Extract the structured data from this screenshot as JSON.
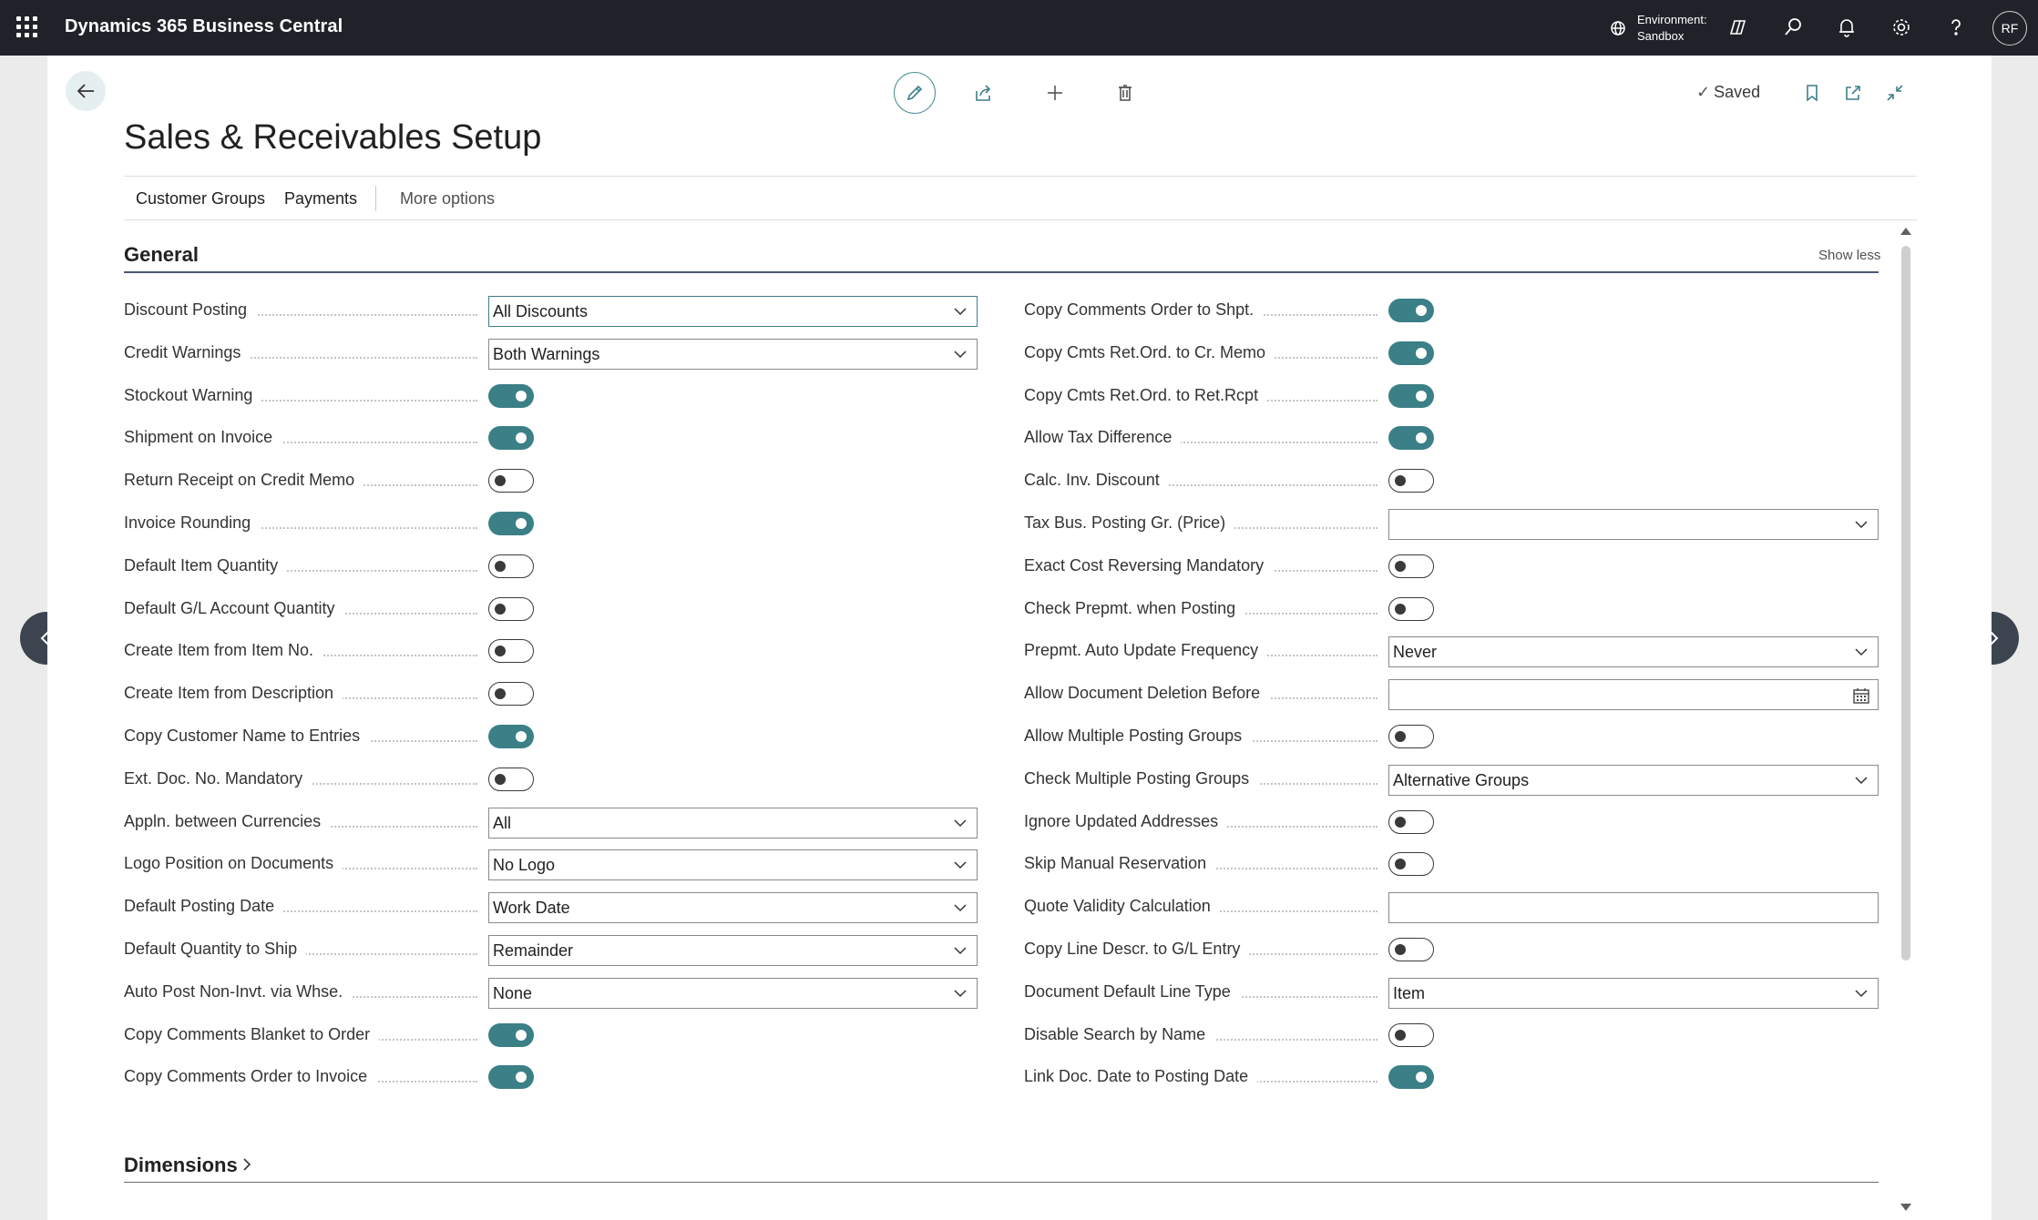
{
  "app": {
    "title": "Dynamics 365 Business Central"
  },
  "environment": {
    "label": "Environment:",
    "name": "Sandbox"
  },
  "user": {
    "initials": "RF"
  },
  "page": {
    "title": "Sales & Receivables Setup",
    "status": "Saved"
  },
  "actions": {
    "customer_groups": "Customer Groups",
    "payments": "Payments",
    "more": "More options"
  },
  "general": {
    "title": "General",
    "show_less": "Show less",
    "left": [
      {
        "label": "Discount Posting",
        "type": "select",
        "value": "All Discounts",
        "focused": true
      },
      {
        "label": "Credit Warnings",
        "type": "select",
        "value": "Both Warnings"
      },
      {
        "label": "Stockout Warning",
        "type": "toggle",
        "on": true
      },
      {
        "label": "Shipment on Invoice",
        "type": "toggle",
        "on": true
      },
      {
        "label": "Return Receipt on Credit Memo",
        "type": "toggle",
        "on": false
      },
      {
        "label": "Invoice Rounding",
        "type": "toggle",
        "on": true
      },
      {
        "label": "Default Item Quantity",
        "type": "toggle",
        "on": false
      },
      {
        "label": "Default G/L Account Quantity",
        "type": "toggle",
        "on": false
      },
      {
        "label": "Create Item from Item No.",
        "type": "toggle",
        "on": false
      },
      {
        "label": "Create Item from Description",
        "type": "toggle",
        "on": false
      },
      {
        "label": "Copy Customer Name to Entries",
        "type": "toggle",
        "on": true
      },
      {
        "label": "Ext. Doc. No. Mandatory",
        "type": "toggle",
        "on": false
      },
      {
        "label": "Appln. between Currencies",
        "type": "select",
        "value": "All"
      },
      {
        "label": "Logo Position on Documents",
        "type": "select",
        "value": "No Logo"
      },
      {
        "label": "Default Posting Date",
        "type": "select",
        "value": "Work Date"
      },
      {
        "label": "Default Quantity to Ship",
        "type": "select",
        "value": "Remainder"
      },
      {
        "label": "Auto Post Non-Invt. via Whse.",
        "type": "select",
        "value": "None"
      },
      {
        "label": "Copy Comments Blanket to Order",
        "type": "toggle",
        "on": true
      },
      {
        "label": "Copy Comments Order to Invoice",
        "type": "toggle",
        "on": true
      }
    ],
    "right": [
      {
        "label": "Copy Comments Order to Shpt.",
        "type": "toggle",
        "on": true
      },
      {
        "label": "Copy Cmts Ret.Ord. to Cr. Memo",
        "type": "toggle",
        "on": true
      },
      {
        "label": "Copy Cmts Ret.Ord. to Ret.Rcpt",
        "type": "toggle",
        "on": true
      },
      {
        "label": "Allow Tax Difference",
        "type": "toggle",
        "on": true
      },
      {
        "label": "Calc. Inv. Discount",
        "type": "toggle",
        "on": false
      },
      {
        "label": "Tax Bus. Posting Gr. (Price)",
        "type": "select",
        "value": ""
      },
      {
        "label": "Exact Cost Reversing Mandatory",
        "type": "toggle",
        "on": false
      },
      {
        "label": "Check Prepmt. when Posting",
        "type": "toggle",
        "on": false
      },
      {
        "label": "Prepmt. Auto Update Frequency",
        "type": "select",
        "value": "Never"
      },
      {
        "label": "Allow Document Deletion Before",
        "type": "date",
        "value": ""
      },
      {
        "label": "Allow Multiple Posting Groups",
        "type": "toggle",
        "on": false
      },
      {
        "label": "Check Multiple Posting Groups",
        "type": "select",
        "value": "Alternative Groups"
      },
      {
        "label": "Ignore Updated Addresses",
        "type": "toggle",
        "on": false
      },
      {
        "label": "Skip Manual Reservation",
        "type": "toggle",
        "on": false
      },
      {
        "label": "Quote Validity Calculation",
        "type": "text",
        "value": ""
      },
      {
        "label": "Copy Line Descr. to G/L Entry",
        "type": "toggle",
        "on": false
      },
      {
        "label": "Document Default Line Type",
        "type": "select",
        "value": "Item"
      },
      {
        "label": "Disable Search by Name",
        "type": "toggle",
        "on": false
      },
      {
        "label": "Link Doc. Date to Posting Date",
        "type": "toggle",
        "on": true
      }
    ]
  },
  "dimensions": {
    "title": "Dimensions"
  },
  "colors": {
    "topbar": "#1f2329",
    "accent": "#3b7f87",
    "section_rule": "#4a5a73"
  },
  "icons": [
    "waffle-icon",
    "environment-icon",
    "copilot-icon",
    "search-icon",
    "bell-icon",
    "gear-icon",
    "help-icon",
    "back-arrow-icon",
    "edit-icon",
    "share-icon",
    "plus-icon",
    "delete-icon",
    "checkmark-icon",
    "bookmark-icon",
    "open-new-window-icon",
    "collapse-icon",
    "chevron-down-icon",
    "calendar-icon",
    "chevron-left-icon",
    "chevron-right-icon"
  ]
}
